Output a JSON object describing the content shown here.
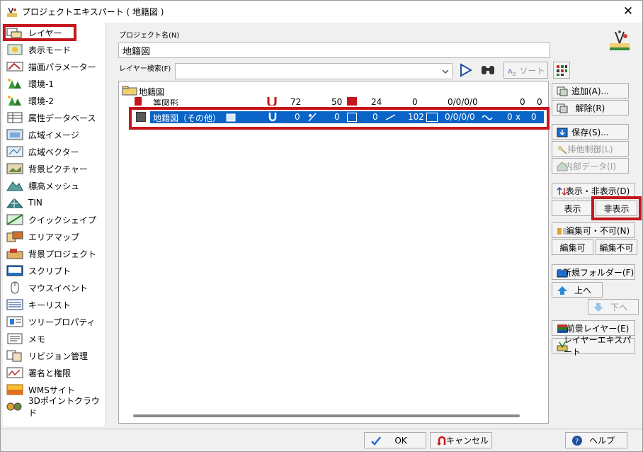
{
  "window": {
    "title": "プロジェクトエキスパート ( 地籍図 )",
    "close_glyph": "✕"
  },
  "sidebar": {
    "items": [
      {
        "label": "レイヤー",
        "icon": "layer-icon"
      },
      {
        "label": "表示モード",
        "icon": "display-mode-icon"
      },
      {
        "label": "描画パラメーター",
        "icon": "drawing-param-icon"
      },
      {
        "label": "環境-1",
        "icon": "environment-icon"
      },
      {
        "label": "環境-2",
        "icon": "environment-icon"
      },
      {
        "label": "属性データベース",
        "icon": "database-icon"
      },
      {
        "label": "広域イメージ",
        "icon": "wide-image-icon"
      },
      {
        "label": "広域ベクター",
        "icon": "wide-vector-icon"
      },
      {
        "label": "背景ピクチャー",
        "icon": "picture-icon"
      },
      {
        "label": "標高メッシュ",
        "icon": "elevation-mesh-icon"
      },
      {
        "label": "TIN",
        "icon": "tin-icon"
      },
      {
        "label": "クイックシェイプ",
        "icon": "quick-shape-icon"
      },
      {
        "label": "エリアマップ",
        "icon": "area-map-icon"
      },
      {
        "label": "背景プロジェクト",
        "icon": "background-project-icon"
      },
      {
        "label": "スクリプト",
        "icon": "script-icon"
      },
      {
        "label": "マウスイベント",
        "icon": "mouse-icon"
      },
      {
        "label": "キーリスト",
        "icon": "key-list-icon"
      },
      {
        "label": "ツリープロパティ",
        "icon": "tree-property-icon"
      },
      {
        "label": "メモ",
        "icon": "memo-icon"
      },
      {
        "label": "リビジョン管理",
        "icon": "revision-icon"
      },
      {
        "label": "署名と権限",
        "icon": "signature-icon"
      },
      {
        "label": "WMSサイト",
        "icon": "wms-icon"
      },
      {
        "label": "3Dポイントクラウド",
        "icon": "point-cloud-icon"
      }
    ]
  },
  "main": {
    "project_name_label": "プロジェクト名(N)",
    "project_name_value": "地籍図",
    "layer_search_label": "レイヤー検索(F)",
    "layer_search_value": "",
    "sort_label": "ソート",
    "tree": {
      "root": "地籍図",
      "row1": {
        "name": "等図形",
        "n1": "72",
        "n2": "50",
        "n3": "24",
        "n4": "0",
        "n5": "0/0/0/0",
        "n6": "0",
        "n7": "0"
      },
      "row2": {
        "name": "地籍図（その他）",
        "n1": "0",
        "n2": "0",
        "n3": "0",
        "n4": "102",
        "n5": "0/0/0/0",
        "n6": "0",
        "x_label": "x",
        "n7": "0"
      }
    }
  },
  "buttons": {
    "add": "追加(A)...",
    "release": "解除(R)",
    "save": "保存(S)...",
    "exclusive": "排他制御(L)",
    "internal": "内部データ(I)",
    "show_hide": "表示・非表示(D)",
    "show": "表示",
    "hide": "非表示",
    "edit_toggle": "編集可・不可(N)",
    "edit_on": "編集可",
    "edit_off": "編集不可",
    "new_folder": "新規フォルダー(F)",
    "up": "上へ",
    "down": "下へ",
    "foreground": "前景レイヤー(E)",
    "layer_expert": "レイヤーエキスパート"
  },
  "footer": {
    "ok": "OK",
    "cancel": "キャンセル",
    "help": "ヘルプ"
  },
  "colors": {
    "highlight": "#c4161c",
    "selection": "#0a64c8",
    "accent_blue": "#1f6fd0"
  }
}
